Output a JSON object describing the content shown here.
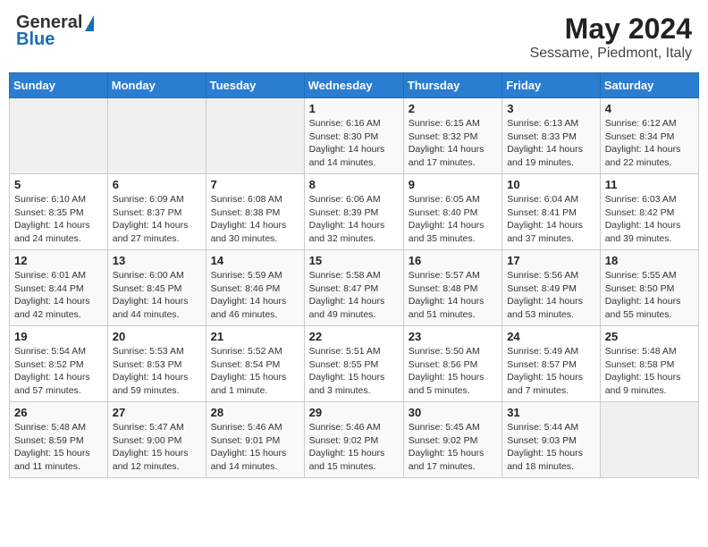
{
  "header": {
    "logo_general": "General",
    "logo_blue": "Blue",
    "title": "May 2024",
    "subtitle": "Sessame, Piedmont, Italy"
  },
  "days_of_week": [
    "Sunday",
    "Monday",
    "Tuesday",
    "Wednesday",
    "Thursday",
    "Friday",
    "Saturday"
  ],
  "weeks": [
    [
      {
        "day": "",
        "info": ""
      },
      {
        "day": "",
        "info": ""
      },
      {
        "day": "",
        "info": ""
      },
      {
        "day": "1",
        "info": "Sunrise: 6:16 AM\nSunset: 8:30 PM\nDaylight: 14 hours and 14 minutes."
      },
      {
        "day": "2",
        "info": "Sunrise: 6:15 AM\nSunset: 8:32 PM\nDaylight: 14 hours and 17 minutes."
      },
      {
        "day": "3",
        "info": "Sunrise: 6:13 AM\nSunset: 8:33 PM\nDaylight: 14 hours and 19 minutes."
      },
      {
        "day": "4",
        "info": "Sunrise: 6:12 AM\nSunset: 8:34 PM\nDaylight: 14 hours and 22 minutes."
      }
    ],
    [
      {
        "day": "5",
        "info": "Sunrise: 6:10 AM\nSunset: 8:35 PM\nDaylight: 14 hours and 24 minutes."
      },
      {
        "day": "6",
        "info": "Sunrise: 6:09 AM\nSunset: 8:37 PM\nDaylight: 14 hours and 27 minutes."
      },
      {
        "day": "7",
        "info": "Sunrise: 6:08 AM\nSunset: 8:38 PM\nDaylight: 14 hours and 30 minutes."
      },
      {
        "day": "8",
        "info": "Sunrise: 6:06 AM\nSunset: 8:39 PM\nDaylight: 14 hours and 32 minutes."
      },
      {
        "day": "9",
        "info": "Sunrise: 6:05 AM\nSunset: 8:40 PM\nDaylight: 14 hours and 35 minutes."
      },
      {
        "day": "10",
        "info": "Sunrise: 6:04 AM\nSunset: 8:41 PM\nDaylight: 14 hours and 37 minutes."
      },
      {
        "day": "11",
        "info": "Sunrise: 6:03 AM\nSunset: 8:42 PM\nDaylight: 14 hours and 39 minutes."
      }
    ],
    [
      {
        "day": "12",
        "info": "Sunrise: 6:01 AM\nSunset: 8:44 PM\nDaylight: 14 hours and 42 minutes."
      },
      {
        "day": "13",
        "info": "Sunrise: 6:00 AM\nSunset: 8:45 PM\nDaylight: 14 hours and 44 minutes."
      },
      {
        "day": "14",
        "info": "Sunrise: 5:59 AM\nSunset: 8:46 PM\nDaylight: 14 hours and 46 minutes."
      },
      {
        "day": "15",
        "info": "Sunrise: 5:58 AM\nSunset: 8:47 PM\nDaylight: 14 hours and 49 minutes."
      },
      {
        "day": "16",
        "info": "Sunrise: 5:57 AM\nSunset: 8:48 PM\nDaylight: 14 hours and 51 minutes."
      },
      {
        "day": "17",
        "info": "Sunrise: 5:56 AM\nSunset: 8:49 PM\nDaylight: 14 hours and 53 minutes."
      },
      {
        "day": "18",
        "info": "Sunrise: 5:55 AM\nSunset: 8:50 PM\nDaylight: 14 hours and 55 minutes."
      }
    ],
    [
      {
        "day": "19",
        "info": "Sunrise: 5:54 AM\nSunset: 8:52 PM\nDaylight: 14 hours and 57 minutes."
      },
      {
        "day": "20",
        "info": "Sunrise: 5:53 AM\nSunset: 8:53 PM\nDaylight: 14 hours and 59 minutes."
      },
      {
        "day": "21",
        "info": "Sunrise: 5:52 AM\nSunset: 8:54 PM\nDaylight: 15 hours and 1 minute."
      },
      {
        "day": "22",
        "info": "Sunrise: 5:51 AM\nSunset: 8:55 PM\nDaylight: 15 hours and 3 minutes."
      },
      {
        "day": "23",
        "info": "Sunrise: 5:50 AM\nSunset: 8:56 PM\nDaylight: 15 hours and 5 minutes."
      },
      {
        "day": "24",
        "info": "Sunrise: 5:49 AM\nSunset: 8:57 PM\nDaylight: 15 hours and 7 minutes."
      },
      {
        "day": "25",
        "info": "Sunrise: 5:48 AM\nSunset: 8:58 PM\nDaylight: 15 hours and 9 minutes."
      }
    ],
    [
      {
        "day": "26",
        "info": "Sunrise: 5:48 AM\nSunset: 8:59 PM\nDaylight: 15 hours and 11 minutes."
      },
      {
        "day": "27",
        "info": "Sunrise: 5:47 AM\nSunset: 9:00 PM\nDaylight: 15 hours and 12 minutes."
      },
      {
        "day": "28",
        "info": "Sunrise: 5:46 AM\nSunset: 9:01 PM\nDaylight: 15 hours and 14 minutes."
      },
      {
        "day": "29",
        "info": "Sunrise: 5:46 AM\nSunset: 9:02 PM\nDaylight: 15 hours and 15 minutes."
      },
      {
        "day": "30",
        "info": "Sunrise: 5:45 AM\nSunset: 9:02 PM\nDaylight: 15 hours and 17 minutes."
      },
      {
        "day": "31",
        "info": "Sunrise: 5:44 AM\nSunset: 9:03 PM\nDaylight: 15 hours and 18 minutes."
      },
      {
        "day": "",
        "info": ""
      }
    ]
  ]
}
